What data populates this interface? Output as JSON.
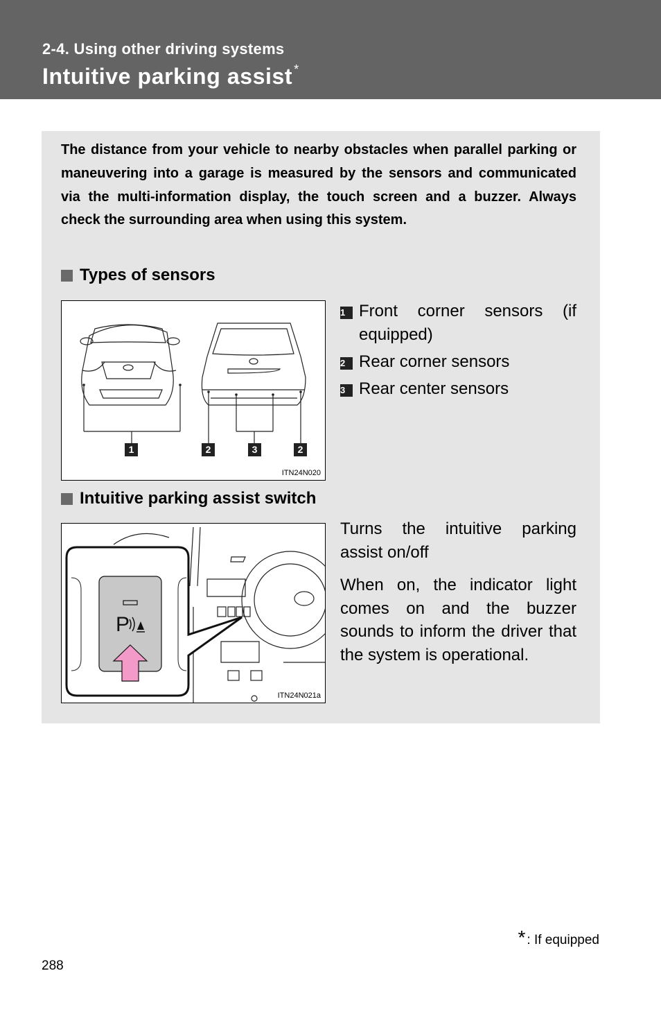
{
  "header": {
    "section": "2-4. Using other driving systems",
    "title": "Intuitive parking assist",
    "title_marker": "*"
  },
  "intro": "The distance from your vehicle to nearby obstacles when parallel parking or maneuvering into a garage is measured by the sensors and communicated via the multi-information display, the touch screen and a buzzer. Always check the surrounding area when using this system.",
  "sections": [
    {
      "heading": "Types of sensors",
      "figure": {
        "code": "ITN24N020",
        "callouts": [
          "1",
          "2",
          "3",
          "2"
        ]
      },
      "legend": [
        {
          "num": "1",
          "label": "Front corner sensors (if equipped)"
        },
        {
          "num": "2",
          "label": "Rear corner sensors"
        },
        {
          "num": "3",
          "label": "Rear center sensors"
        }
      ]
    },
    {
      "heading": "Intuitive parking assist switch",
      "figure": {
        "code": "ITN24N021a",
        "switch_symbol": "P",
        "arrow_color": "#f49ac8"
      },
      "paragraphs": [
        "Turns the intuitive parking assist on/off",
        "When on, the indicator light comes on and the buzzer sounds to inform the driver that the system is operational."
      ]
    }
  ],
  "footnote": {
    "marker": "*",
    "text": ": If equipped"
  },
  "page_number": "288"
}
